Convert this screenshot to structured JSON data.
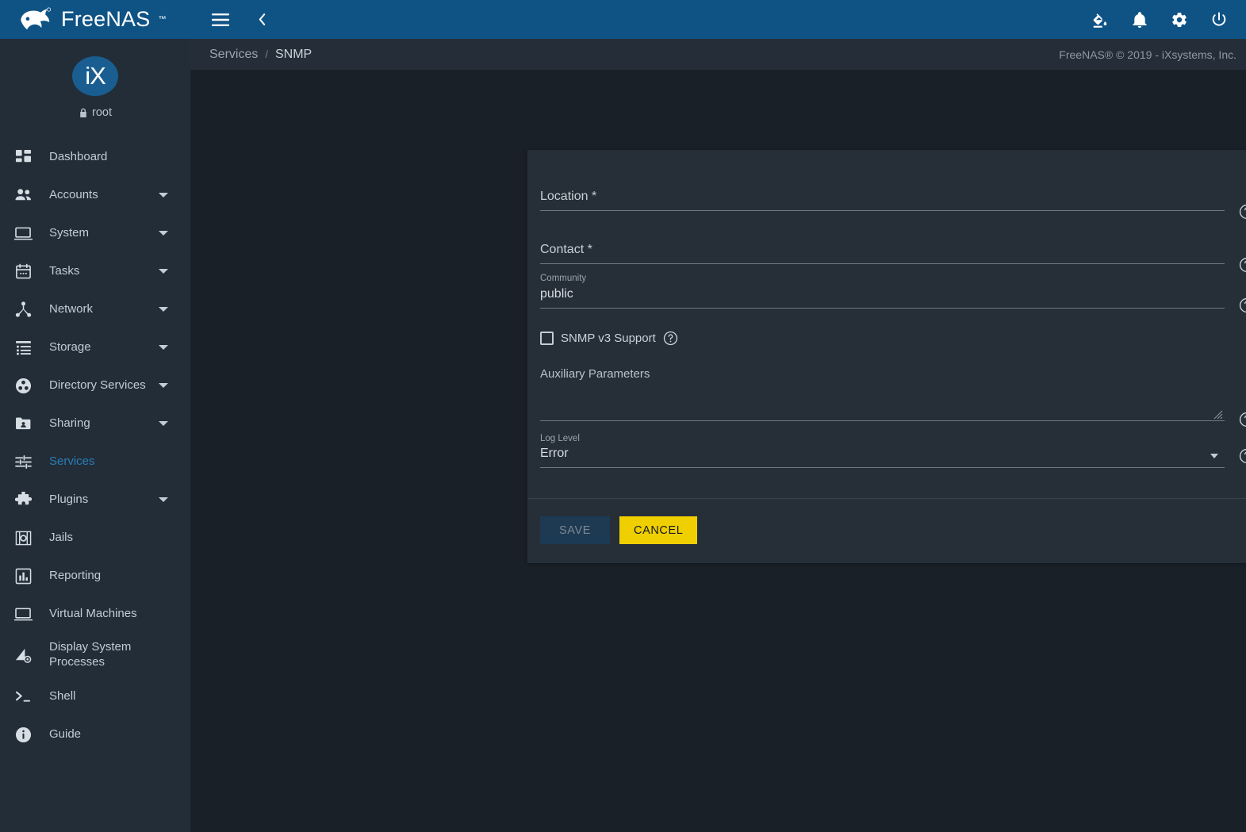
{
  "brand": {
    "name": "FreeNAS",
    "trademark": "™",
    "logo_icon": "freenas-fish-logo"
  },
  "user": {
    "avatar_text": "iX",
    "name": "root",
    "lock_icon": "lock-icon"
  },
  "sidebar": {
    "items": [
      {
        "label": "Dashboard",
        "icon": "dashboard-icon",
        "expandable": false,
        "active": false
      },
      {
        "label": "Accounts",
        "icon": "accounts-people-icon",
        "expandable": true,
        "active": false
      },
      {
        "label": "System",
        "icon": "system-monitor-icon",
        "expandable": true,
        "active": false
      },
      {
        "label": "Tasks",
        "icon": "tasks-calendar-icon",
        "expandable": true,
        "active": false
      },
      {
        "label": "Network",
        "icon": "network-share-icon",
        "expandable": true,
        "active": false
      },
      {
        "label": "Storage",
        "icon": "storage-list-icon",
        "expandable": true,
        "active": false
      },
      {
        "label": "Directory Services",
        "icon": "directory-services-icon",
        "expandable": true,
        "active": false
      },
      {
        "label": "Sharing",
        "icon": "sharing-folder-icon",
        "expandable": true,
        "active": false
      },
      {
        "label": "Services",
        "icon": "services-sliders-icon",
        "expandable": false,
        "active": true
      },
      {
        "label": "Plugins",
        "icon": "plugins-puzzle-icon",
        "expandable": true,
        "active": false
      },
      {
        "label": "Jails",
        "icon": "jails-icon",
        "expandable": false,
        "active": false
      },
      {
        "label": "Reporting",
        "icon": "reporting-chart-icon",
        "expandable": false,
        "active": false
      },
      {
        "label": "Virtual Machines",
        "icon": "virtual-machines-icon",
        "expandable": false,
        "active": false
      },
      {
        "label": "Display System Processes",
        "icon": "display-system-processes-icon",
        "expandable": false,
        "active": false
      },
      {
        "label": "Shell",
        "icon": "shell-prompt-icon",
        "expandable": false,
        "active": false
      },
      {
        "label": "Guide",
        "icon": "guide-info-icon",
        "expandable": false,
        "active": false
      }
    ]
  },
  "topbar": {
    "menu_icon": "hamburger-menu-icon",
    "collapse_icon": "chevron-left-icon",
    "theme_icon": "paint-bucket-icon",
    "notifications_icon": "bell-icon",
    "settings_icon": "gear-icon",
    "power_icon": "power-icon"
  },
  "breadcrumb": {
    "items": [
      "Services",
      "SNMP"
    ],
    "separator": "/",
    "copyright": "FreeNAS® © 2019 - iXsystems, Inc."
  },
  "form": {
    "location": {
      "label": "Location *",
      "value": "",
      "help_icon": "help-circle-icon"
    },
    "contact": {
      "label": "Contact *",
      "value": "",
      "help_icon": "help-circle-icon"
    },
    "community": {
      "label": "Community",
      "value": "public",
      "help_icon": "help-circle-icon"
    },
    "snmp_v3": {
      "label": "SNMP v3 Support",
      "checked": false,
      "help_icon": "help-circle-icon"
    },
    "auxiliary_parameters": {
      "label": "Auxiliary Parameters",
      "value": "",
      "help_icon": "help-circle-icon",
      "resize_icon": "resize-grip-icon"
    },
    "log_level": {
      "label": "Log Level",
      "value": "Error",
      "help_icon": "help-circle-icon",
      "caret_icon": "chevron-down-icon"
    },
    "buttons": {
      "save": "SAVE",
      "cancel": "CANCEL"
    }
  },
  "colors": {
    "header_blue": "#0f5385",
    "accent_blue": "#2a7eb8",
    "sidebar_bg": "#222d38",
    "page_bg": "#1a2028",
    "card_bg": "#262e38",
    "cancel_yellow": "#f0cf00",
    "save_bg": "#1d3a52"
  }
}
